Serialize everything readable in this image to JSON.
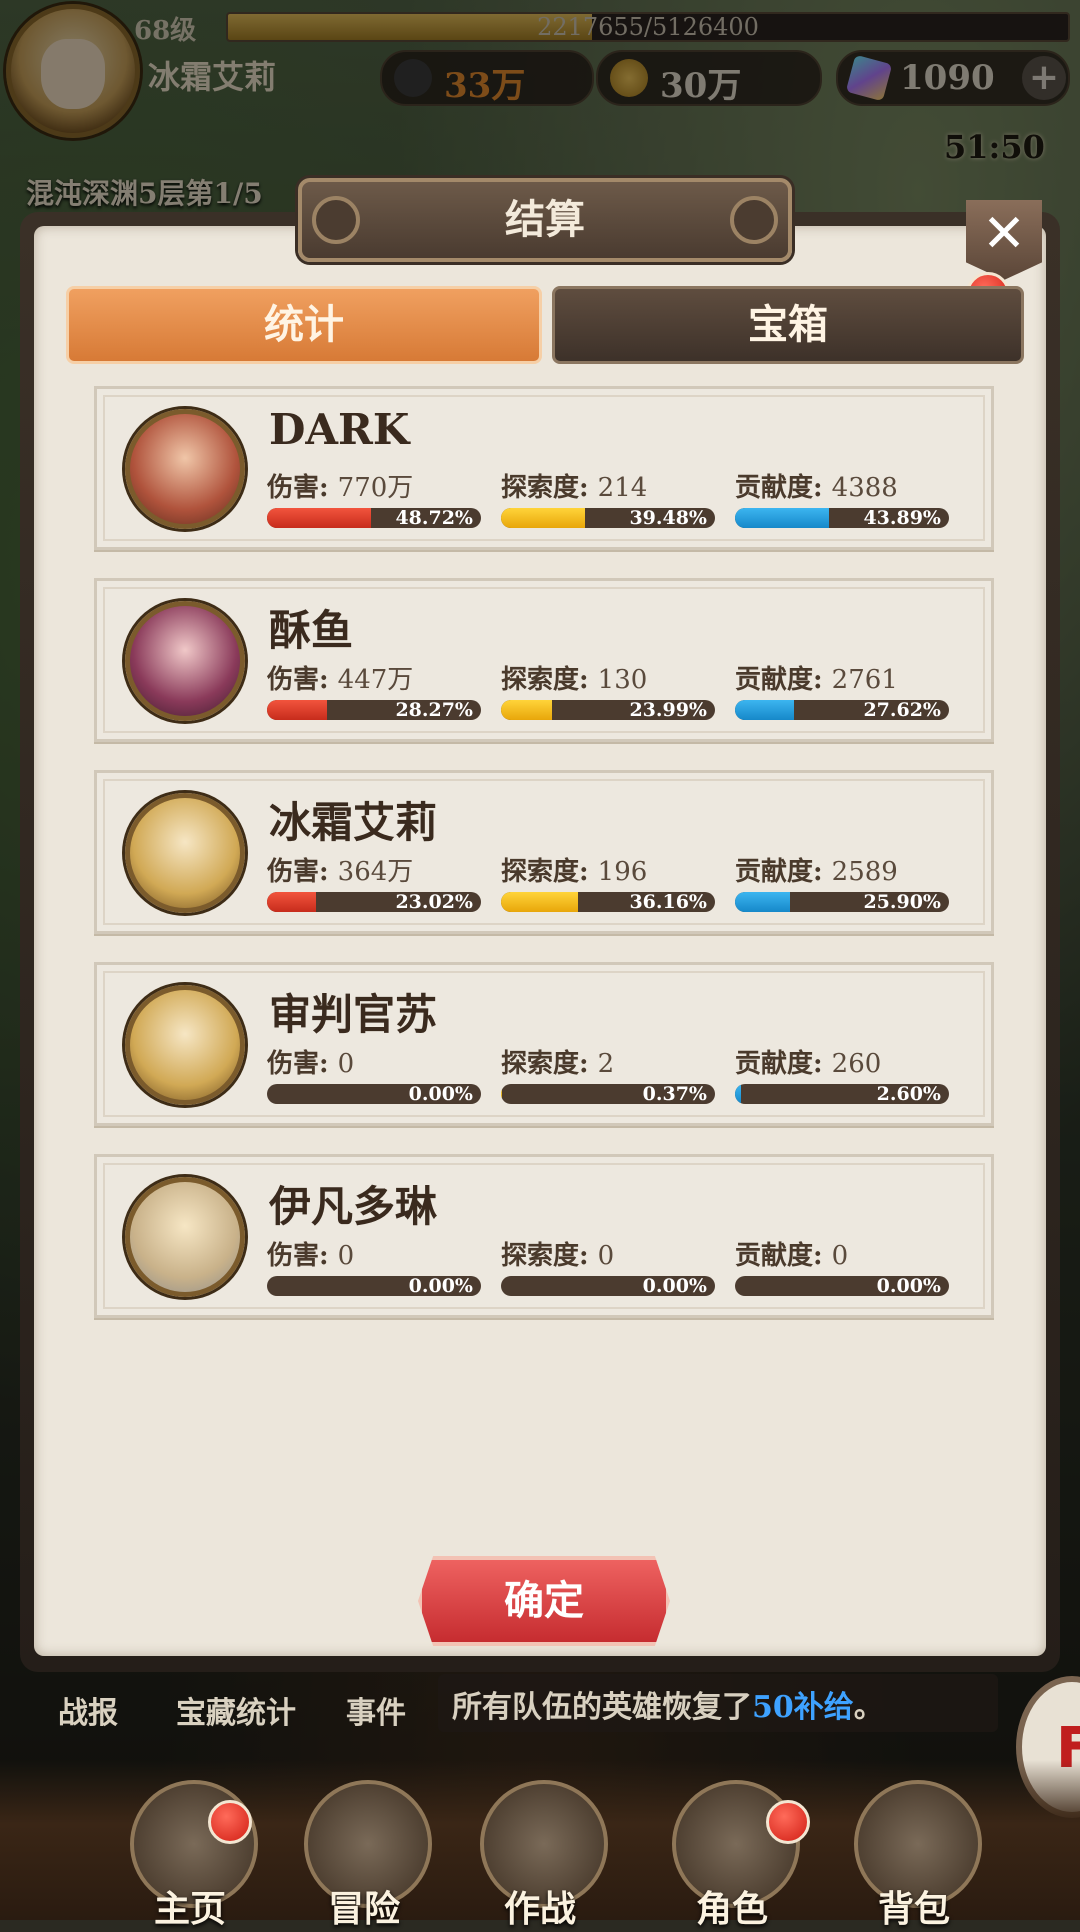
{
  "player": {
    "level": "68级",
    "exp_text": "2217655/5126400",
    "exp_fraction": 0.433,
    "name": "冰霜艾莉",
    "power": "33万",
    "gold": "30万",
    "gems": "1090",
    "add_label": "+"
  },
  "timer": "51:50",
  "stage_text": "混沌深渊5层第1/5",
  "dialog": {
    "title": "结算",
    "close_label": "✕",
    "tabs": [
      {
        "label": "统计",
        "active": true
      },
      {
        "label": "宝箱",
        "active": false
      }
    ],
    "stat_labels": {
      "damage": "伤害:",
      "explore": "探索度:",
      "contrib": "贡献度:"
    },
    "players": [
      {
        "name": "DARK",
        "damage": "770万",
        "damage_pct": "48.72%",
        "damage_frac": 0.4872,
        "explore": "214",
        "explore_pct": "39.48%",
        "explore_frac": 0.3948,
        "contrib": "4388",
        "contrib_pct": "43.89%",
        "contrib_frac": 0.4389
      },
      {
        "name": "酥鱼",
        "damage": "447万",
        "damage_pct": "28.27%",
        "damage_frac": 0.2827,
        "explore": "130",
        "explore_pct": "23.99%",
        "explore_frac": 0.2399,
        "contrib": "2761",
        "contrib_pct": "27.62%",
        "contrib_frac": 0.2762
      },
      {
        "name": "冰霜艾莉",
        "damage": "364万",
        "damage_pct": "23.02%",
        "damage_frac": 0.2302,
        "explore": "196",
        "explore_pct": "36.16%",
        "explore_frac": 0.3616,
        "contrib": "2589",
        "contrib_pct": "25.90%",
        "contrib_frac": 0.259
      },
      {
        "name": "审判官苏",
        "damage": "0",
        "damage_pct": "0.00%",
        "damage_frac": 0,
        "explore": "2",
        "explore_pct": "0.37%",
        "explore_frac": 0.0037,
        "contrib": "260",
        "contrib_pct": "2.60%",
        "contrib_frac": 0.026
      },
      {
        "name": "伊凡多琳",
        "damage": "0",
        "damage_pct": "0.00%",
        "damage_frac": 0,
        "explore": "0",
        "explore_pct": "0.00%",
        "explore_frac": 0,
        "contrib": "0",
        "contrib_pct": "0.00%",
        "contrib_frac": 0
      }
    ],
    "confirm_label": "确定"
  },
  "bottom_links": [
    "战报",
    "宝藏统计",
    "事件"
  ],
  "message": {
    "prefix": "所有队伍的英雄恢复了",
    "highlight": "50补给",
    "suffix": "。"
  },
  "side_button": "F",
  "nav": [
    "主页",
    "冒险",
    "作战",
    "角色",
    "背包"
  ],
  "colors": {
    "damage": "#e0402c",
    "explore": "#f3c020",
    "contrib": "#249fe0",
    "tab_active": "#e58a46",
    "confirm": "#d9413f"
  }
}
